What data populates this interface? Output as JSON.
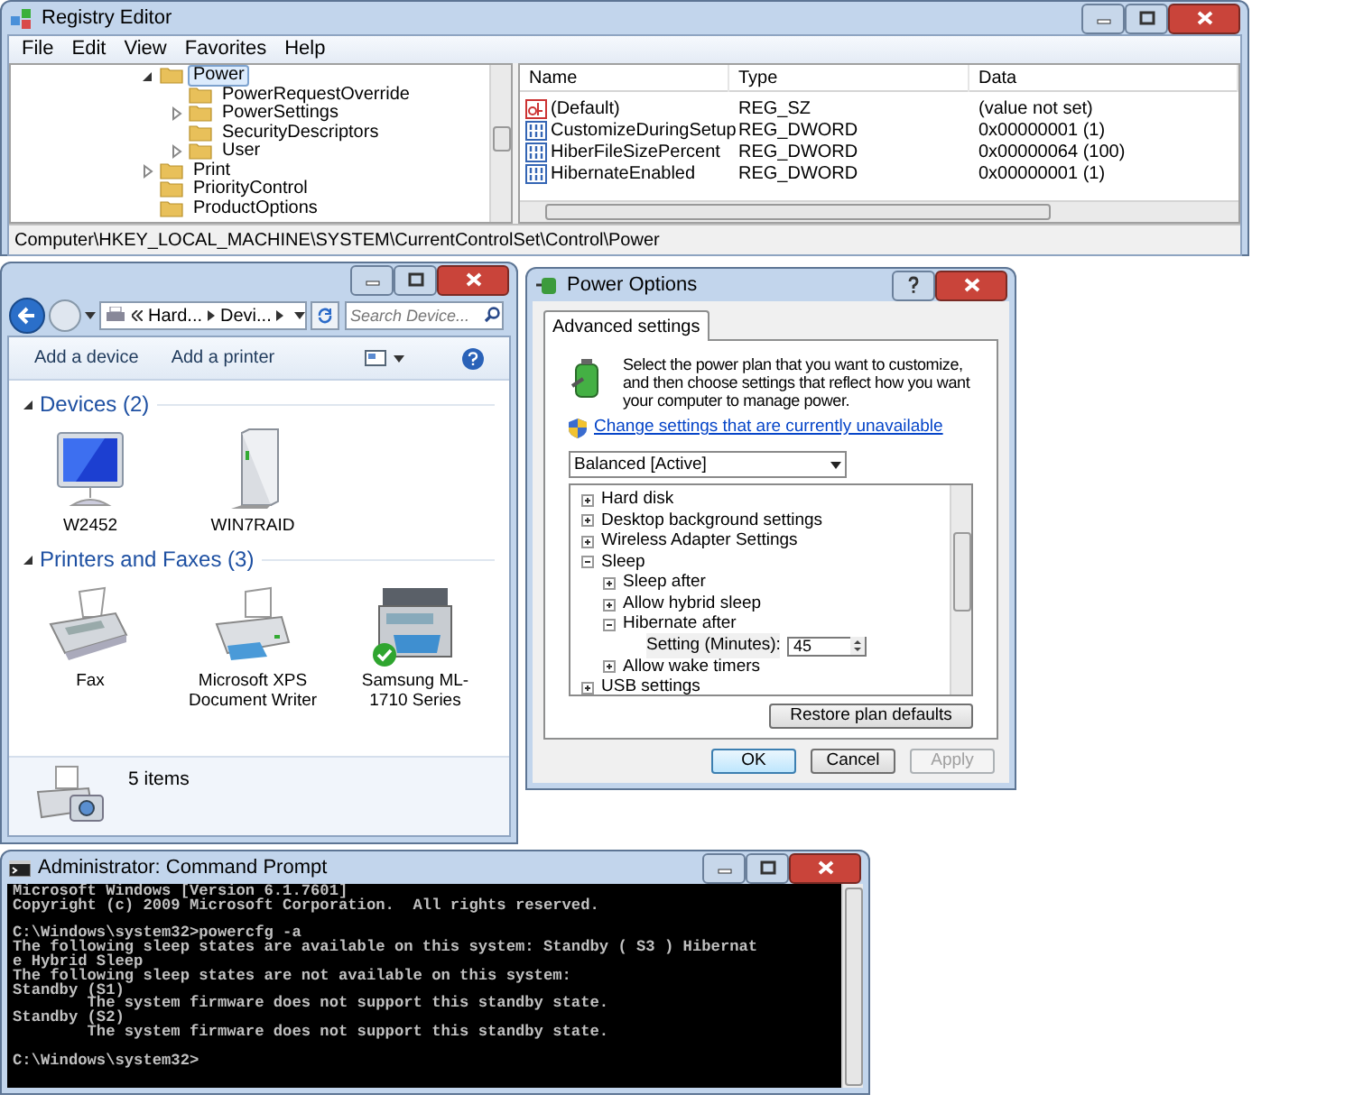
{
  "registry_editor": {
    "title": "Registry Editor",
    "menu": [
      "File",
      "Edit",
      "View",
      "Favorites",
      "Help"
    ],
    "tree": [
      {
        "label": "Power",
        "expanded": true,
        "selected": true,
        "children": [
          {
            "label": "PowerRequestOverride",
            "selected": false
          },
          {
            "label": "PowerSettings",
            "expanded": false,
            "selected": false
          },
          {
            "label": "SecurityDescriptors",
            "selected": false
          },
          {
            "label": "User",
            "expanded": false,
            "selected": false
          }
        ]
      },
      {
        "label": "Print",
        "expanded": false,
        "selected": false
      },
      {
        "label": "PriorityControl",
        "selected": false
      },
      {
        "label": "ProductOptions",
        "selected": false
      }
    ],
    "columns": [
      "Name",
      "Type",
      "Data"
    ],
    "values": [
      {
        "kind": "string",
        "name": "(Default)",
        "type": "REG_SZ",
        "data": "(value not set)"
      },
      {
        "kind": "dword",
        "name": "CustomizeDuringSetup",
        "type": "REG_DWORD",
        "data": "0x00000001 (1)"
      },
      {
        "kind": "dword",
        "name": "HiberFileSizePercent",
        "type": "REG_DWORD",
        "data": "0x00000064 (100)"
      },
      {
        "kind": "dword",
        "name": "HibernateEnabled",
        "type": "REG_DWORD",
        "data": "0x00000001 (1)"
      }
    ],
    "address": "Computer\\HKEY_LOCAL_MACHINE\\SYSTEM\\CurrentControlSet\\Control\\Power"
  },
  "devices_window": {
    "breadcrumb": [
      "Hard...",
      "Devi..."
    ],
    "search_placeholder": "Search Device...",
    "toolbar": [
      "Add a device",
      "Add a printer"
    ],
    "sections": [
      {
        "title": "Devices (2)",
        "items": [
          {
            "kind": "monitor",
            "label": "W2452",
            "default": false
          },
          {
            "kind": "drive",
            "label": "WIN7RAID",
            "default": false
          }
        ]
      },
      {
        "title": "Printers and Faxes (3)",
        "items": [
          {
            "kind": "fax",
            "label": "Fax",
            "default": false
          },
          {
            "kind": "printer",
            "label": "Microsoft XPS Document Writer",
            "default": false
          },
          {
            "kind": "multifunction",
            "label": "Samsung ML-1710 Series",
            "default": true
          }
        ]
      }
    ],
    "status": "5 items"
  },
  "power_options": {
    "title": "Power Options",
    "tabs": [
      {
        "label": "Advanced settings",
        "selected": true
      }
    ],
    "description": "Select the power plan that you want to customize, and then choose settings that reflect how you want your computer to manage power.",
    "link": "Change settings that are currently unavailable",
    "plan": "Balanced [Active]",
    "settings": [
      {
        "kind": "group",
        "label": "Hard disk",
        "expanded": false
      },
      {
        "kind": "group",
        "label": "Desktop background settings",
        "expanded": false
      },
      {
        "kind": "group",
        "label": "Wireless Adapter Settings",
        "expanded": false
      },
      {
        "kind": "group",
        "label": "Sleep",
        "expanded": true,
        "children": [
          {
            "kind": "group",
            "label": "Sleep after",
            "expanded": false
          },
          {
            "kind": "group",
            "label": "Allow hybrid sleep",
            "expanded": false
          },
          {
            "kind": "group",
            "label": "Hibernate after",
            "expanded": true,
            "children": [
              {
                "kind": "spinner",
                "label": "Setting (Minutes):",
                "value": "45"
              }
            ]
          },
          {
            "kind": "group",
            "label": "Allow wake timers",
            "expanded": false
          }
        ]
      },
      {
        "kind": "group",
        "label": "USB settings",
        "expanded": false
      }
    ],
    "restore_button": "Restore plan defaults",
    "buttons": [
      {
        "label": "OK",
        "disabled": false,
        "default": true
      },
      {
        "label": "Cancel",
        "disabled": false,
        "default": false
      },
      {
        "label": "Apply",
        "disabled": true,
        "default": false
      }
    ]
  },
  "command_prompt": {
    "title": "Administrator: Command Prompt",
    "blocks": [
      [
        "Microsoft Windows [Version 6.1.7601]",
        "Copyright (c) 2009 Microsoft Corporation.  All rights reserved."
      ],
      [
        "C:\\Windows\\system32>powercfg -a",
        "The following sleep states are available on this system: Standby ( S3 ) Hibernat",
        "e Hybrid Sleep",
        "The following sleep states are not available on this system:",
        "Standby (S1)",
        "        The system firmware does not support this standby state.",
        "Standby (S2)",
        "        The system firmware does not support this standby state."
      ],
      [
        "C:\\Windows\\system32>"
      ]
    ]
  }
}
